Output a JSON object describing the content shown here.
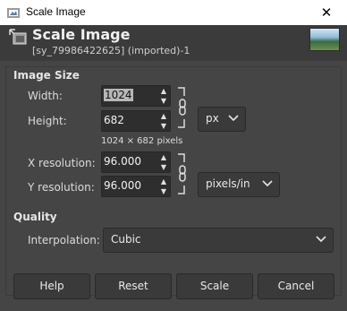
{
  "window": {
    "title": "Scale Image",
    "close_glyph": "✕"
  },
  "header": {
    "heading": "Scale Image",
    "subheading": "[sy_79986422625] (imported)-1",
    "icon": "scale-icon",
    "thumbnail": "image-thumbnail"
  },
  "image_size": {
    "section_label": "Image Size",
    "width_label": "Width:",
    "width_value": "1024",
    "height_label": "Height:",
    "height_value": "682",
    "readout": "1024 × 682 pixels",
    "unit": "px",
    "x_res_label": "X resolution:",
    "x_res_value": "96.000",
    "y_res_label": "Y resolution:",
    "y_res_value": "96.000",
    "res_unit": "pixels/in"
  },
  "quality": {
    "section_label": "Quality",
    "interp_label": "Interpolation:",
    "interp_value": "Cubic"
  },
  "buttons": {
    "help": "Help",
    "reset": "Reset",
    "scale": "Scale",
    "cancel": "Cancel"
  },
  "colors": {
    "background": "#454545",
    "header": "#3b3b3b",
    "field": "#2e2e2e"
  }
}
